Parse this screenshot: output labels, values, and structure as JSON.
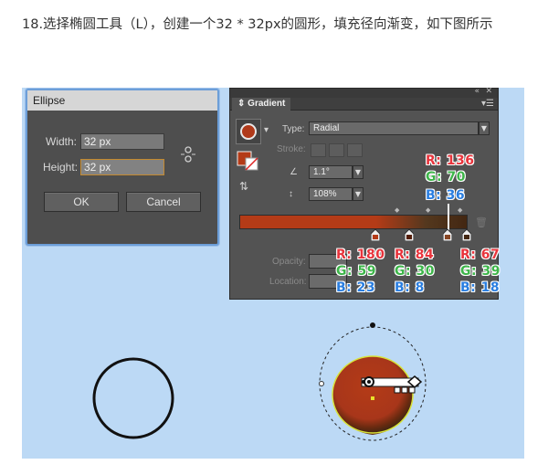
{
  "caption": "18.选择椭圆工具（L），创建一个32 * 32px的圆形，填充径向渐变，如下图所示",
  "ellipse_dialog": {
    "title": "Ellipse",
    "width_label": "Width:",
    "width_value": "32 px",
    "height_label": "Height:",
    "height_value": "32 px",
    "ok_label": "OK",
    "cancel_label": "Cancel",
    "link_icon": "constrain-proportions-icon"
  },
  "gradient_panel": {
    "tab_title": "Gradient",
    "collapse_icon": "double-chevron-icon",
    "close_icon": "close-icon",
    "menu_icon": "panel-menu-icon",
    "type_label": "Type:",
    "type_value": "Radial",
    "stroke_label": "Stroke:",
    "angle_value": "1.1°",
    "aspect_value": "108%",
    "opacity_label": "Opacity:",
    "location_label": "Location:"
  },
  "annotations": {
    "top": {
      "r": "R: 136",
      "g": "G: 70",
      "b": "B: 36"
    },
    "stops": [
      {
        "r": "R: 180",
        "g": "G: 59",
        "b": "B: 23"
      },
      {
        "r": "R: 84",
        "g": "G: 30",
        "b": "B: 8"
      },
      {
        "r": "R: 67",
        "g": "G: 39",
        "b": "B: 18"
      }
    ]
  },
  "colors": {
    "canvas_bg": "#bcd9f5",
    "fill_main": "#b43b17",
    "fill_mid": "#541e08",
    "fill_dark": "#432712"
  }
}
